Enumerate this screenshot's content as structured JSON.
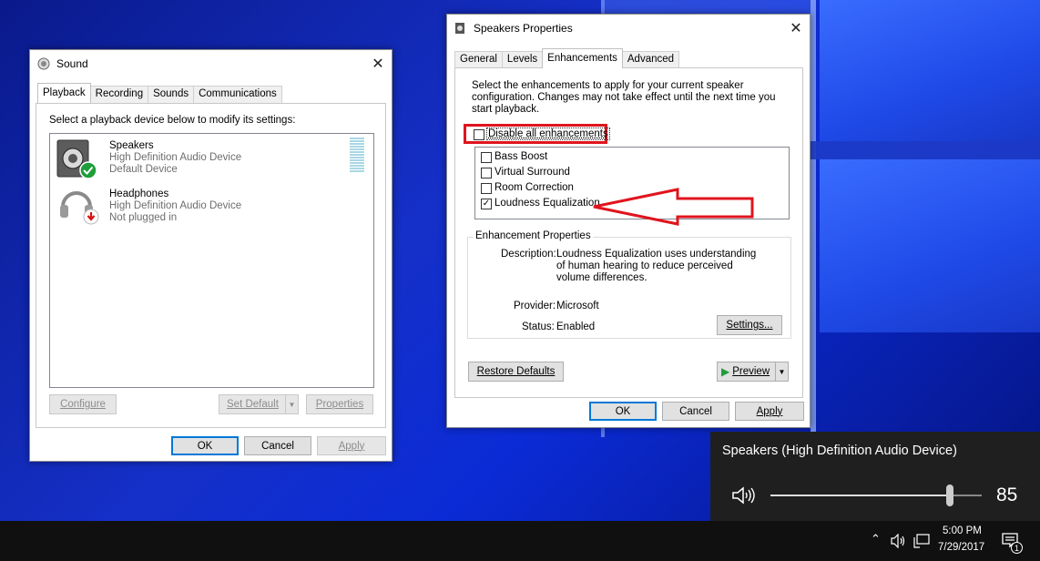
{
  "sound": {
    "title": "Sound",
    "tabs": [
      "Playback",
      "Recording",
      "Sounds",
      "Communications"
    ],
    "instruction": "Select a playback device below to modify its settings:",
    "devices": [
      {
        "name": "Speakers",
        "line1": "High Definition Audio Device",
        "line2": "Default Device"
      },
      {
        "name": "Headphones",
        "line1": "High Definition Audio Device",
        "line2": "Not plugged in"
      }
    ],
    "configure": "Configure",
    "set_default": "Set Default",
    "properties": "Properties",
    "ok": "OK",
    "cancel": "Cancel",
    "apply": "Apply"
  },
  "props": {
    "title": "Speakers Properties",
    "tabs": [
      "General",
      "Levels",
      "Enhancements",
      "Advanced"
    ],
    "intro": "Select the enhancements to apply for your current speaker configuration. Changes may not take effect until the next time you start playback.",
    "disable_all": "Disable all enhancements",
    "enhancements": [
      {
        "label": "Bass Boost",
        "checked": false
      },
      {
        "label": "Virtual Surround",
        "checked": false
      },
      {
        "label": "Room Correction",
        "checked": false
      },
      {
        "label": "Loudness Equalization",
        "checked": true
      }
    ],
    "group_title": "Enhancement Properties",
    "description_label": "Description:",
    "description": "Loudness Equalization uses understanding of human hearing to reduce perceived volume differences.",
    "provider_label": "Provider:",
    "provider": "Microsoft",
    "status_label": "Status:",
    "status": "Enabled",
    "settings_btn": "Settings...",
    "restore_defaults": "Restore Defaults",
    "preview": "Preview",
    "ok": "OK",
    "cancel": "Cancel",
    "apply": "Apply"
  },
  "flyout": {
    "device": "Speakers (High Definition Audio Device)",
    "volume": "85",
    "volume_fraction": 0.85
  },
  "taskbar": {
    "time": "5:00 PM",
    "date": "7/29/2017",
    "notification_count": "1"
  },
  "colors": {
    "highlight_red": "#e0141e",
    "accent": "#0078d7"
  }
}
